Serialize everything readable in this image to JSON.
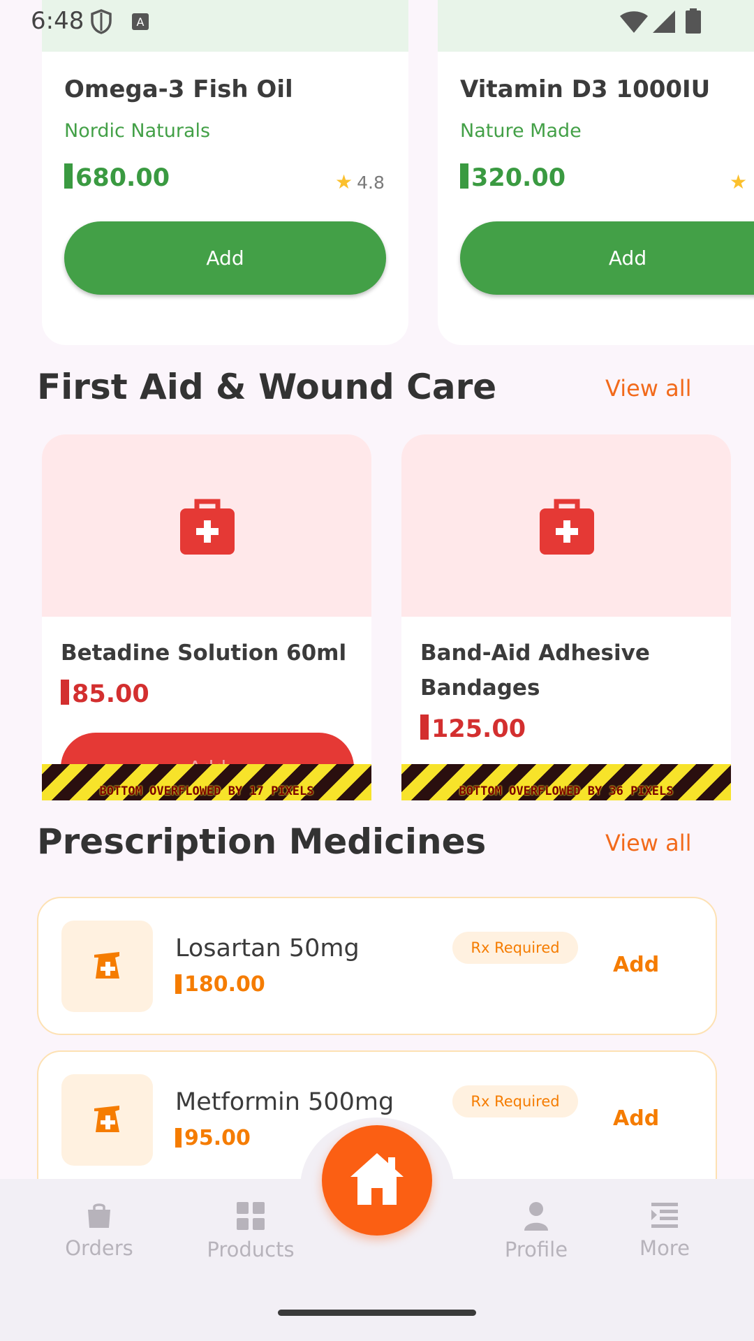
{
  "status_bar": {
    "time": "6:48"
  },
  "supplements": [
    {
      "name": "Omega-3 Fish Oil",
      "brand": "Nordic Naturals",
      "price": "680.00",
      "rating": "4.8",
      "add_label": "Add"
    },
    {
      "name": "Vitamin D3 1000IU",
      "brand": "Nature Made",
      "price": "320.00",
      "rating": "",
      "add_label": "Add"
    }
  ],
  "first_aid": {
    "title": "First Aid & Wound Care",
    "view_all": "View all",
    "items": [
      {
        "name": "Betadine Solution 60ml",
        "price": "85.00",
        "add_label": "Add",
        "overflow": "BOTTOM OVERFLOWED BY 17 PIXELS"
      },
      {
        "name": "Band-Aid Adhesive Bandages",
        "price": "125.00",
        "overflow": "BOTTOM OVERFLOWED BY 36 PIXELS"
      }
    ]
  },
  "prescription": {
    "title": "Prescription Medicines",
    "view_all": "View all",
    "items": [
      {
        "name": "Losartan 50mg",
        "price": "180.00",
        "badge": "Rx Required",
        "add_label": "Add"
      },
      {
        "name": "Metformin 500mg",
        "price": "95.00",
        "badge": "Rx Required",
        "add_label": "Add"
      }
    ]
  },
  "nav": {
    "orders": "Orders",
    "products": "Products",
    "profile": "Profile",
    "more": "More"
  },
  "colors": {
    "brand": "#fb5f13",
    "green": "#43a047",
    "red": "#e53935",
    "orange": "#f57c00"
  },
  "icons": [
    "shield-icon",
    "keyboard-icon",
    "wifi-icon",
    "signal-icon",
    "battery-icon",
    "star-icon",
    "first-aid-kit-icon",
    "medicine-icon",
    "bag-icon",
    "grid-icon",
    "home-icon",
    "person-icon",
    "menu-icon"
  ]
}
